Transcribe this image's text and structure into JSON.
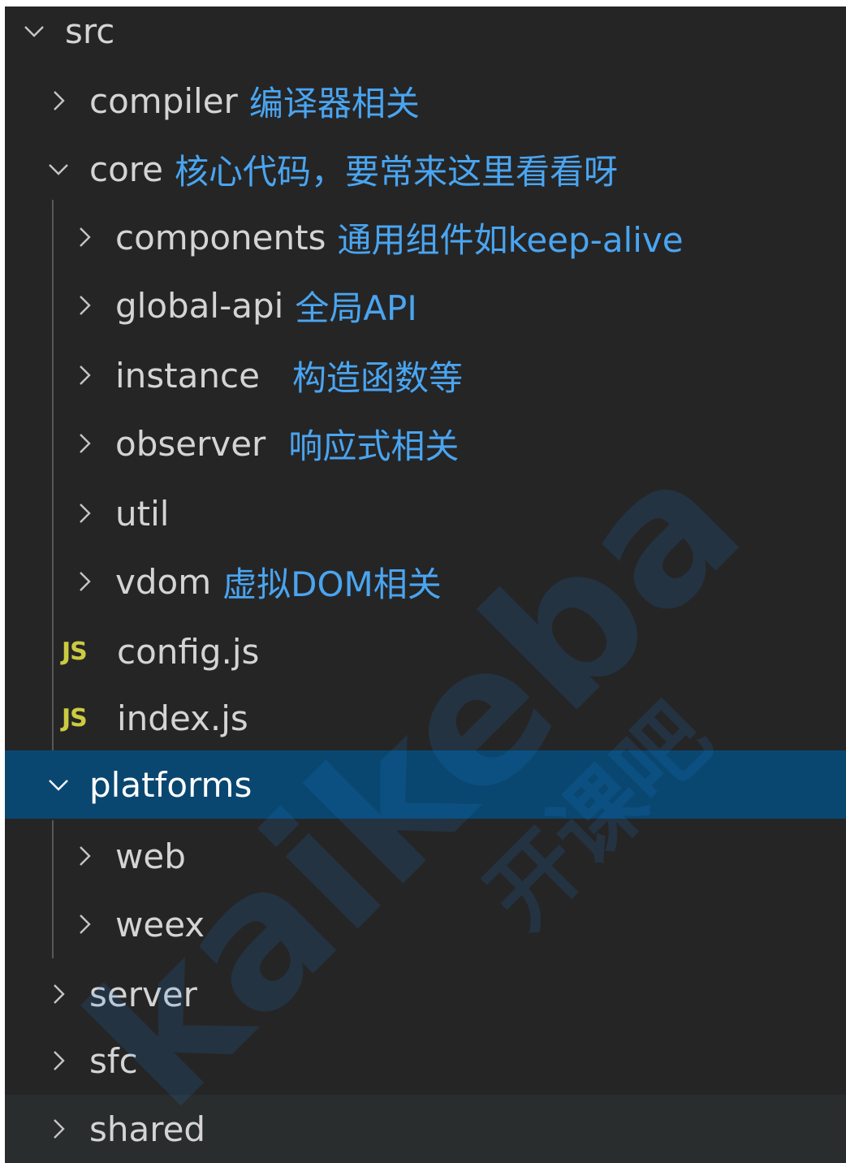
{
  "explorer": {
    "root": {
      "name": "src",
      "expanded": true
    },
    "items": [
      {
        "name": "compiler",
        "note": "编译器相关",
        "expanded": false
      },
      {
        "name": "core",
        "note": "核心代码，要常来这里看看呀",
        "expanded": true
      },
      {
        "name": "components",
        "note": "通用组件如keep-alive",
        "expanded": false
      },
      {
        "name": "global-api",
        "note": "全局API",
        "expanded": false
      },
      {
        "name": "instance",
        "note": "构造函数等",
        "expanded": false
      },
      {
        "name": "observer",
        "note": "响应式相关",
        "expanded": false
      },
      {
        "name": "util",
        "expanded": false
      },
      {
        "name": "vdom",
        "note": "虚拟DOM相关",
        "expanded": false
      },
      {
        "name": "config.js",
        "icon": "JS"
      },
      {
        "name": "index.js",
        "icon": "JS"
      },
      {
        "name": "platforms",
        "expanded": true,
        "selected": true
      },
      {
        "name": "web",
        "expanded": false
      },
      {
        "name": "weex",
        "expanded": false
      },
      {
        "name": "server",
        "expanded": false
      },
      {
        "name": "sfc",
        "expanded": false
      },
      {
        "name": "shared",
        "expanded": false
      }
    ]
  },
  "watermark": {
    "logo": "kaikeba",
    "text": "开课吧"
  },
  "colors": {
    "background": "#252526",
    "selection": "#094771",
    "text": "#d4d4d4",
    "annotation": "#4aa5f0",
    "js_icon": "#cbcb41",
    "guide": "#585858"
  }
}
